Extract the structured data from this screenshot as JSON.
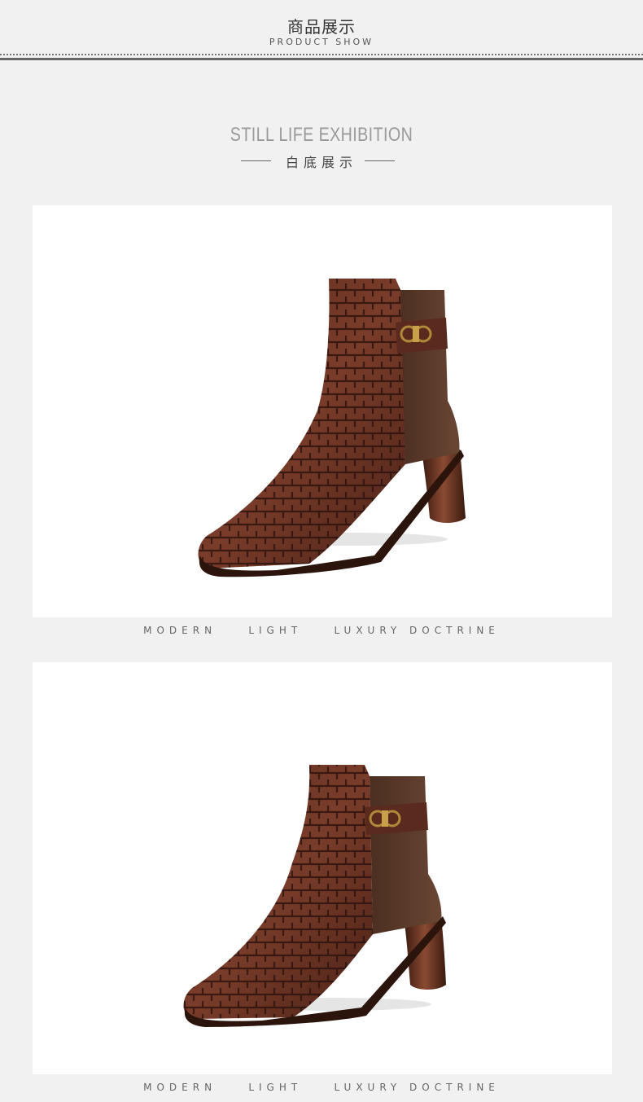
{
  "header": {
    "title_cn": "商品展示",
    "title_en": "PRODUCT SHOW"
  },
  "section": {
    "title_en": "STILL LIFE  EXHIBITION",
    "subtitle_cn": "白底展示"
  },
  "photos": [
    {
      "caption": "MODERN    LIGHT    LUXURY DOCTRINE",
      "subject": "brown woven leather ankle boot"
    },
    {
      "caption": "MODERN    LIGHT    LUXURY DOCTRINE",
      "subject": "brown woven leather ankle boot"
    }
  ],
  "colors": {
    "page_bg": "#f1f1f1",
    "panel_bg": "#ffffff",
    "boot_leather": "#6b3324",
    "boot_suede": "#5a3a2a",
    "buckle": "#b08a3a"
  }
}
